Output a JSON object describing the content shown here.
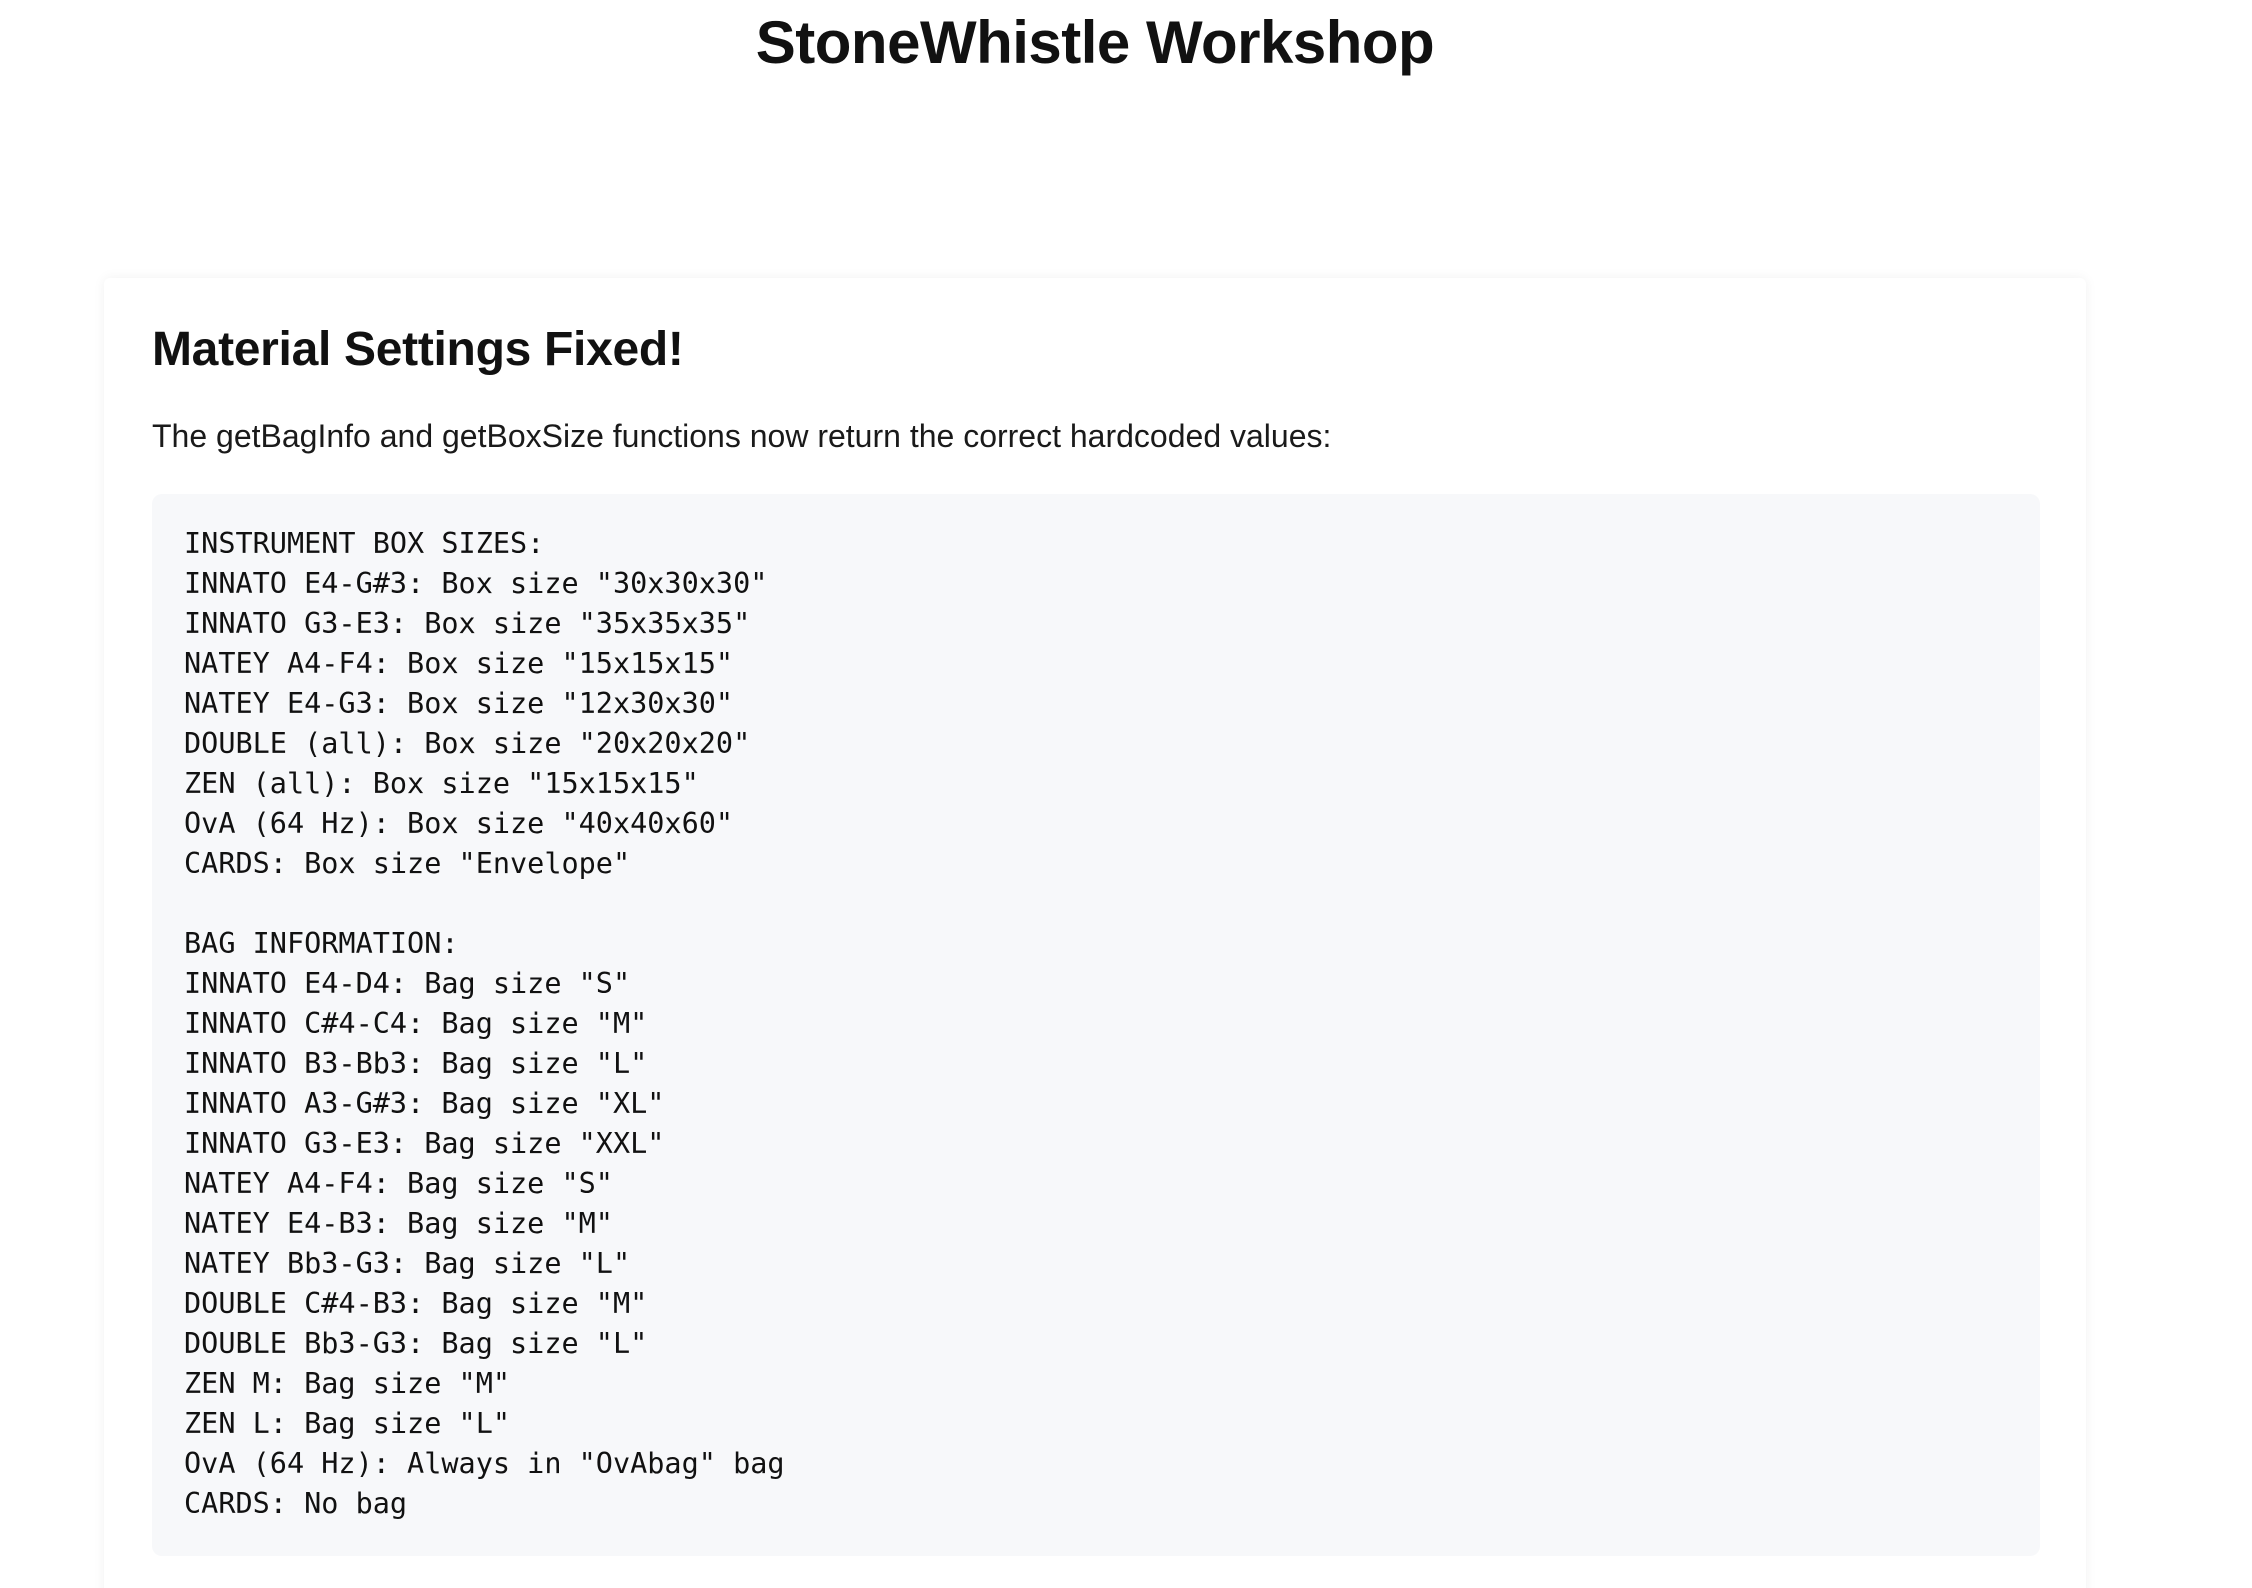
{
  "page": {
    "title": "StoneWhistle Workshop"
  },
  "card": {
    "title": "Material Settings Fixed!",
    "description": "The getBagInfo and getBoxSize functions now return the correct hardcoded values:",
    "code_lines": [
      "INSTRUMENT BOX SIZES:",
      "INNATO E4-G#3: Box size \"30x30x30\"",
      "INNATO G3-E3: Box size \"35x35x35\"",
      "NATEY A4-F4: Box size \"15x15x15\"",
      "NATEY E4-G3: Box size \"12x30x30\"",
      "DOUBLE (all): Box size \"20x20x20\"",
      "ZEN (all): Box size \"15x15x15\"",
      "OvA (64 Hz): Box size \"40x40x60\"",
      "CARDS: Box size \"Envelope\"",
      "",
      "BAG INFORMATION:",
      "INNATO E4-D4: Bag size \"S\"",
      "INNATO C#4-C4: Bag size \"M\"",
      "INNATO B3-Bb3: Bag size \"L\"",
      "INNATO A3-G#3: Bag size \"XL\"",
      "INNATO G3-E3: Bag size \"XXL\"",
      "NATEY A4-F4: Bag size \"S\"",
      "NATEY E4-B3: Bag size \"M\"",
      "NATEY Bb3-G3: Bag size \"L\"",
      "DOUBLE C#4-B3: Bag size \"M\"",
      "DOUBLE Bb3-G3: Bag size \"L\"",
      "ZEN M: Bag size \"M\"",
      "ZEN L: Bag size \"L\"",
      "OvA (64 Hz): Always in \"OvAbag\" bag",
      "CARDS: No bag"
    ]
  }
}
